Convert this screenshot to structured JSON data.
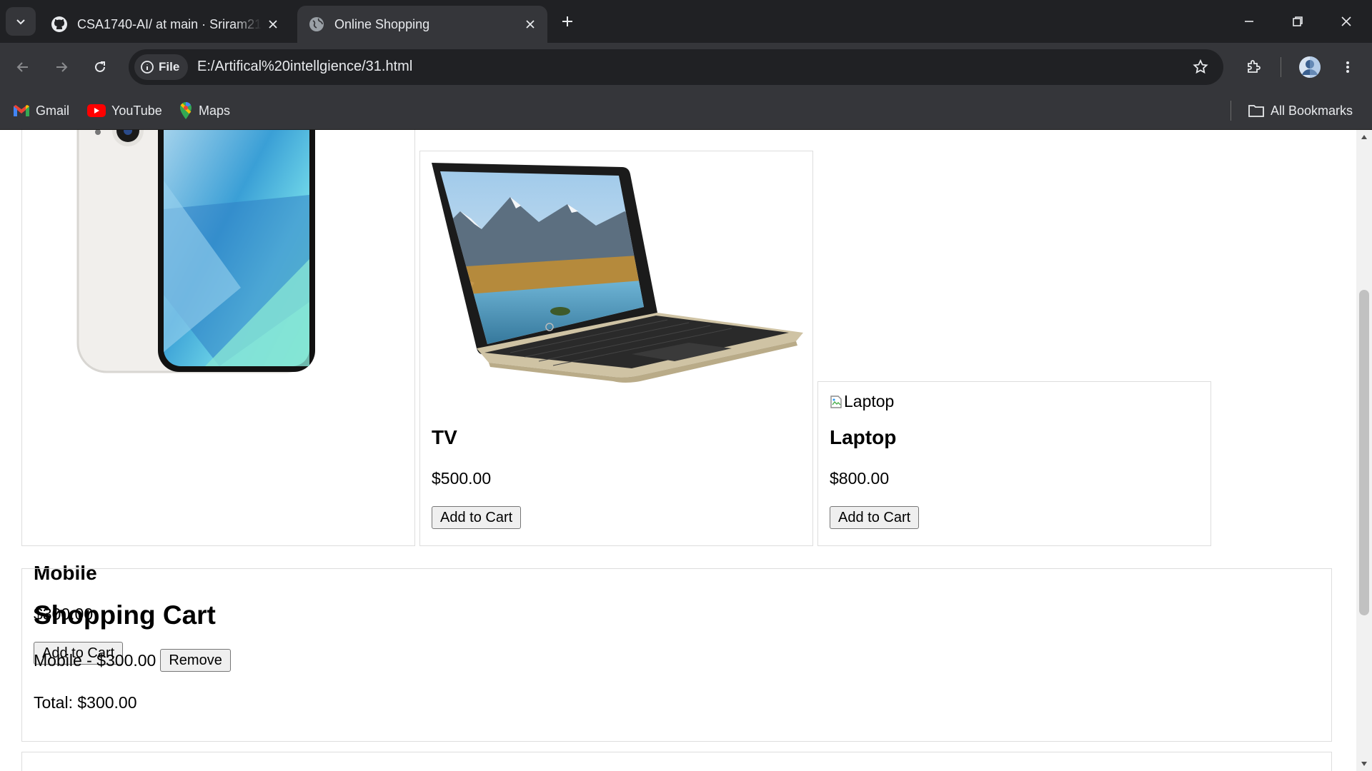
{
  "browser": {
    "tabs": [
      {
        "title": "CSA1740-AI/ at main · Sriram21",
        "icon": "github-icon"
      },
      {
        "title": "Online Shopping",
        "icon": "globe-icon"
      }
    ],
    "address": {
      "chip_label": "File",
      "url": "E:/Artifical%20intellgience/31.html"
    },
    "bookmarks": [
      {
        "label": "Gmail",
        "icon": "gmail-icon"
      },
      {
        "label": "YouTube",
        "icon": "youtube-icon"
      },
      {
        "label": "Maps",
        "icon": "maps-icon"
      }
    ],
    "all_bookmarks_label": "All Bookmarks"
  },
  "products": [
    {
      "name": "Mobile",
      "price": "$300.00",
      "button": "Add to Cart",
      "image": "phone-image"
    },
    {
      "name": "TV",
      "price": "$500.00",
      "button": "Add to Cart",
      "image": "laptop-image"
    },
    {
      "name": "Laptop",
      "price": "$800.00",
      "button": "Add to Cart",
      "image_alt": "Laptop"
    }
  ],
  "cart": {
    "title": "Shopping Cart",
    "items": [
      {
        "text": "Mobile - $300.00",
        "button": "Remove"
      }
    ],
    "total": "Total: $300.00"
  },
  "colors": {
    "chrome_dark": "#202124",
    "chrome_toolbar": "#35363a",
    "card_border": "#dddddd"
  }
}
